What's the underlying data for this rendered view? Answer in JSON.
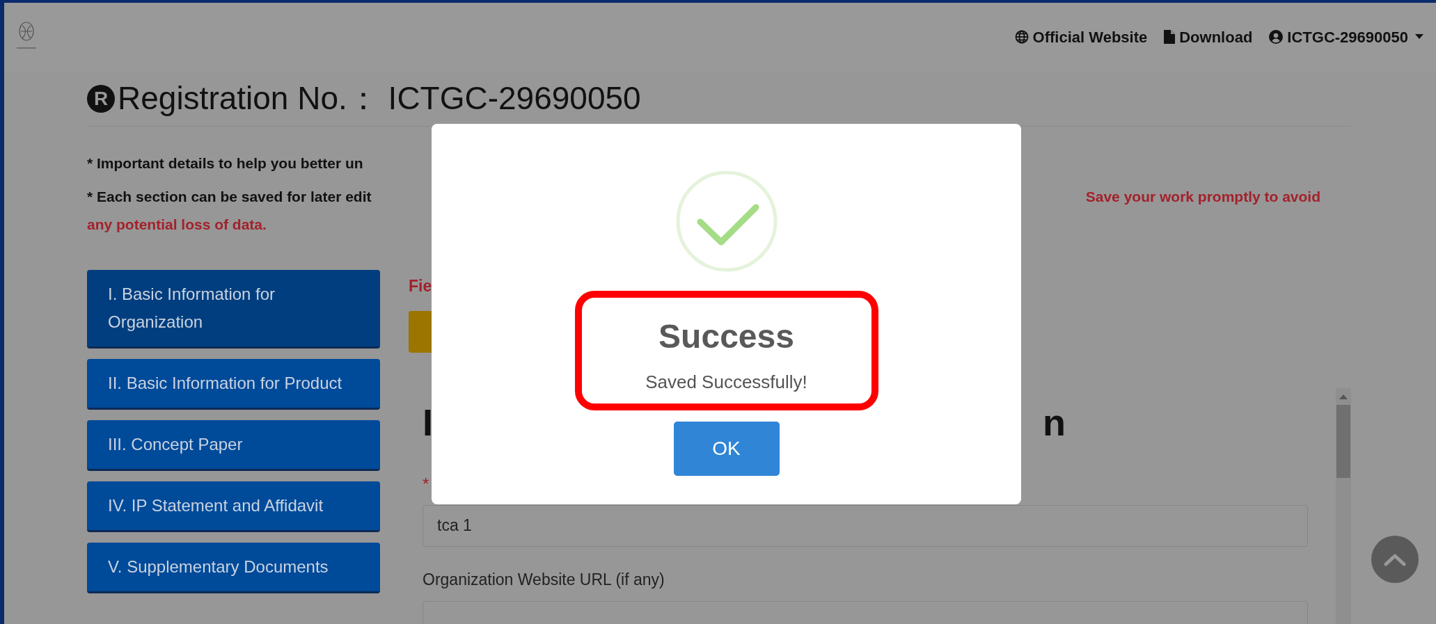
{
  "header": {
    "nav": [
      {
        "kind": "globe",
        "label": "Official Website"
      },
      {
        "kind": "file",
        "label": "Download"
      },
      {
        "kind": "user",
        "label": "ICTGC-29690050"
      }
    ]
  },
  "page_title": {
    "badge": "R",
    "text": "Registration No.： ICTGC-29690050"
  },
  "notes": {
    "line_1": "* Important details to help you better un",
    "line_2_left": "* Each section can be saved for later edit",
    "line_2_right": "Save your work promptly to avoid",
    "line_3": "any potential loss of data."
  },
  "sidebar": {
    "items": [
      {
        "label": "I. Basic Information for Organization",
        "selected": true
      },
      {
        "label": "II. Basic Information for Product",
        "selected": false
      },
      {
        "label": "III. Concept Paper",
        "selected": false
      },
      {
        "label": "IV. IP Statement and Affidavit",
        "selected": false
      },
      {
        "label": "V. Supplementary Documents",
        "selected": false
      }
    ]
  },
  "form": {
    "notice": "Fie",
    "heading_left": "I",
    "heading_right": "n",
    "required_mark": "*",
    "name_value": "tca 1",
    "url_label": "Organization Website URL (if any)"
  },
  "dialog": {
    "title": "Success",
    "message": "Saved Successfully!",
    "button": "OK"
  }
}
